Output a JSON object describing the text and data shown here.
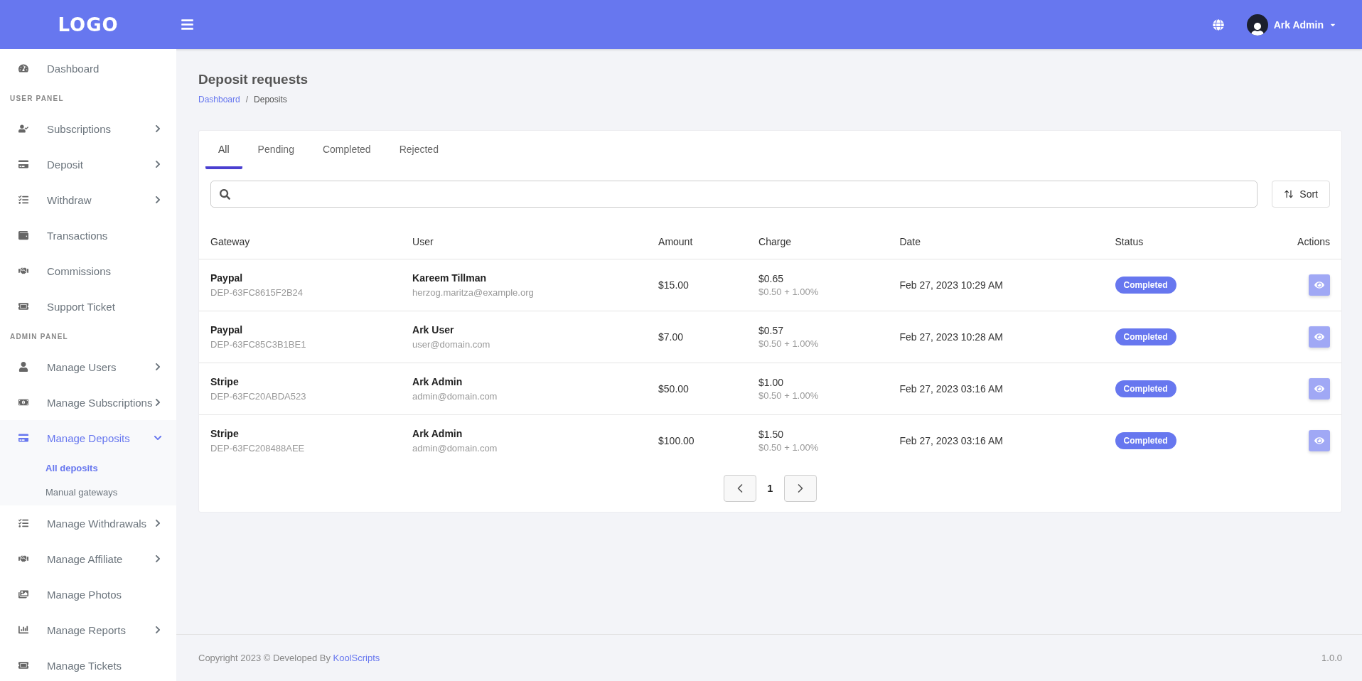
{
  "topbar": {
    "logo": "LOGO",
    "user_name": "Ark Admin"
  },
  "sidebar": {
    "groups": [
      {
        "items": [
          {
            "label": "Dashboard",
            "kind": "link",
            "selected": false
          }
        ]
      },
      {
        "heading": "USER PANEL",
        "items": [
          {
            "label": "Subscriptions",
            "kind": "menu",
            "expanded": false,
            "selected": false
          },
          {
            "label": "Deposit",
            "kind": "menu",
            "expanded": false,
            "selected": false
          },
          {
            "label": "Withdraw",
            "kind": "menu",
            "expanded": false,
            "selected": false
          },
          {
            "label": "Transactions",
            "kind": "link",
            "selected": false
          },
          {
            "label": "Commissions",
            "kind": "link",
            "selected": false
          },
          {
            "label": "Support Ticket",
            "kind": "link",
            "selected": false
          }
        ]
      },
      {
        "heading": "ADMIN PANEL",
        "items": [
          {
            "label": "Manage Users",
            "kind": "menu",
            "expanded": false,
            "selected": false
          },
          {
            "label": "Manage Subscriptions",
            "kind": "menu",
            "expanded": false,
            "selected": false
          },
          {
            "label": "Manage Deposits",
            "kind": "menu",
            "expanded": true,
            "selected": true,
            "children": [
              {
                "label": "All deposits",
                "selected": true
              },
              {
                "label": "Manual gateways",
                "selected": false
              }
            ]
          },
          {
            "label": "Manage Withdrawals",
            "kind": "menu",
            "expanded": false,
            "selected": false
          },
          {
            "label": "Manage Affiliate",
            "kind": "menu",
            "expanded": false,
            "selected": false
          },
          {
            "label": "Manage Photos",
            "kind": "link",
            "selected": false
          },
          {
            "label": "Manage Reports",
            "kind": "menu",
            "expanded": false,
            "selected": false
          },
          {
            "label": "Manage Tickets",
            "kind": "link",
            "selected": false
          }
        ]
      }
    ]
  },
  "page": {
    "title": "Deposit requests",
    "breadcrumb": [
      "Dashboard",
      "Deposits"
    ],
    "breadcrumb_separator": "/"
  },
  "tabs": [
    {
      "label": "All",
      "selected": true
    },
    {
      "label": "Pending",
      "selected": false
    },
    {
      "label": "Completed",
      "selected": false
    },
    {
      "label": "Rejected",
      "selected": false
    }
  ],
  "sort_button": "Sort",
  "table": {
    "columns": [
      "Gateway",
      "User",
      "Amount",
      "Charge",
      "Date",
      "Status",
      "Actions"
    ],
    "rows": [
      {
        "gateway": "Paypal",
        "reference": "DEP-63FC8615F2B24",
        "user": "Kareem Tillman",
        "email": "herzog.maritza@example.org",
        "amount": "$15.00",
        "charge": "$0.65",
        "charge_formula": "$0.50 + 1.00%",
        "date": "Feb 27, 2023 10:29 AM",
        "status": "Completed"
      },
      {
        "gateway": "Paypal",
        "reference": "DEP-63FC85C3B1BE1",
        "user": "Ark User",
        "email": "user@domain.com",
        "amount": "$7.00",
        "charge": "$0.57",
        "charge_formula": "$0.50 + 1.00%",
        "date": "Feb 27, 2023 10:28 AM",
        "status": "Completed"
      },
      {
        "gateway": "Stripe",
        "reference": "DEP-63FC20ABDA523",
        "user": "Ark Admin",
        "email": "admin@domain.com",
        "amount": "$50.00",
        "charge": "$1.00",
        "charge_formula": "$0.50 + 1.00%",
        "date": "Feb 27, 2023 03:16 AM",
        "status": "Completed"
      },
      {
        "gateway": "Stripe",
        "reference": "DEP-63FC208488AEE",
        "user": "Ark Admin",
        "email": "admin@domain.com",
        "amount": "$100.00",
        "charge": "$1.50",
        "charge_formula": "$0.50 + 1.00%",
        "date": "Feb 27, 2023 03:16 AM",
        "status": "Completed"
      }
    ]
  },
  "pagination": {
    "pages": [
      {
        "label": "1",
        "selected": true
      }
    ]
  },
  "footer": {
    "copyright": "Copyright 2023 © Developed By",
    "link": "KoolScripts",
    "version": "1.0.0"
  }
}
